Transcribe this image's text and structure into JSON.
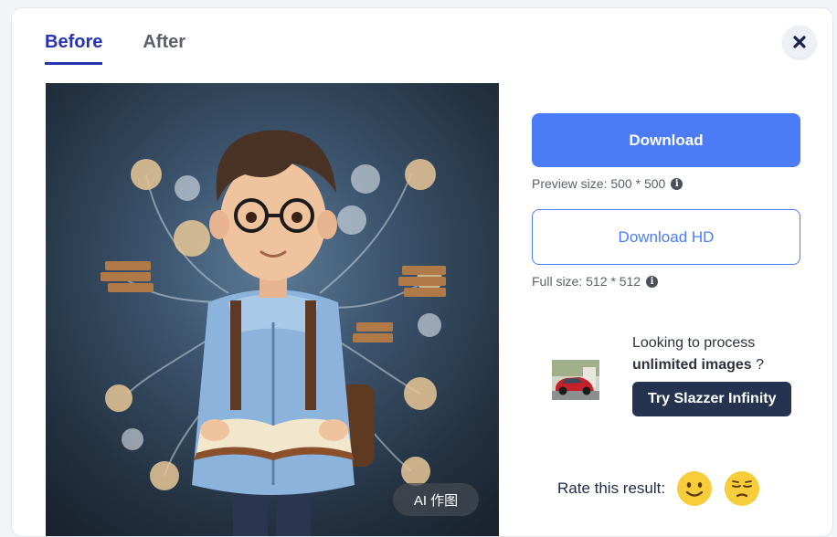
{
  "tabs": [
    {
      "label": "Before",
      "active": true
    },
    {
      "label": "After",
      "active": false
    }
  ],
  "preview": {
    "badge": "AI 作图"
  },
  "download": {
    "label": "Download",
    "preview_size_text": "Preview size: 500 * 500"
  },
  "download_hd": {
    "label": "Download HD",
    "full_size_text": "Full size: 512 * 512"
  },
  "promo": {
    "line1": "Looking to process",
    "line2_bold": "unlimited images",
    "line2_rest": " ?",
    "button_label": "Try Slazzer Infinity"
  },
  "rating": {
    "label": "Rate this result:",
    "options": [
      "happy-face",
      "disappointed-face"
    ]
  },
  "colors": {
    "accent": "#4b7cf6",
    "tab_active": "#2634b4",
    "dark_button": "#253350"
  }
}
